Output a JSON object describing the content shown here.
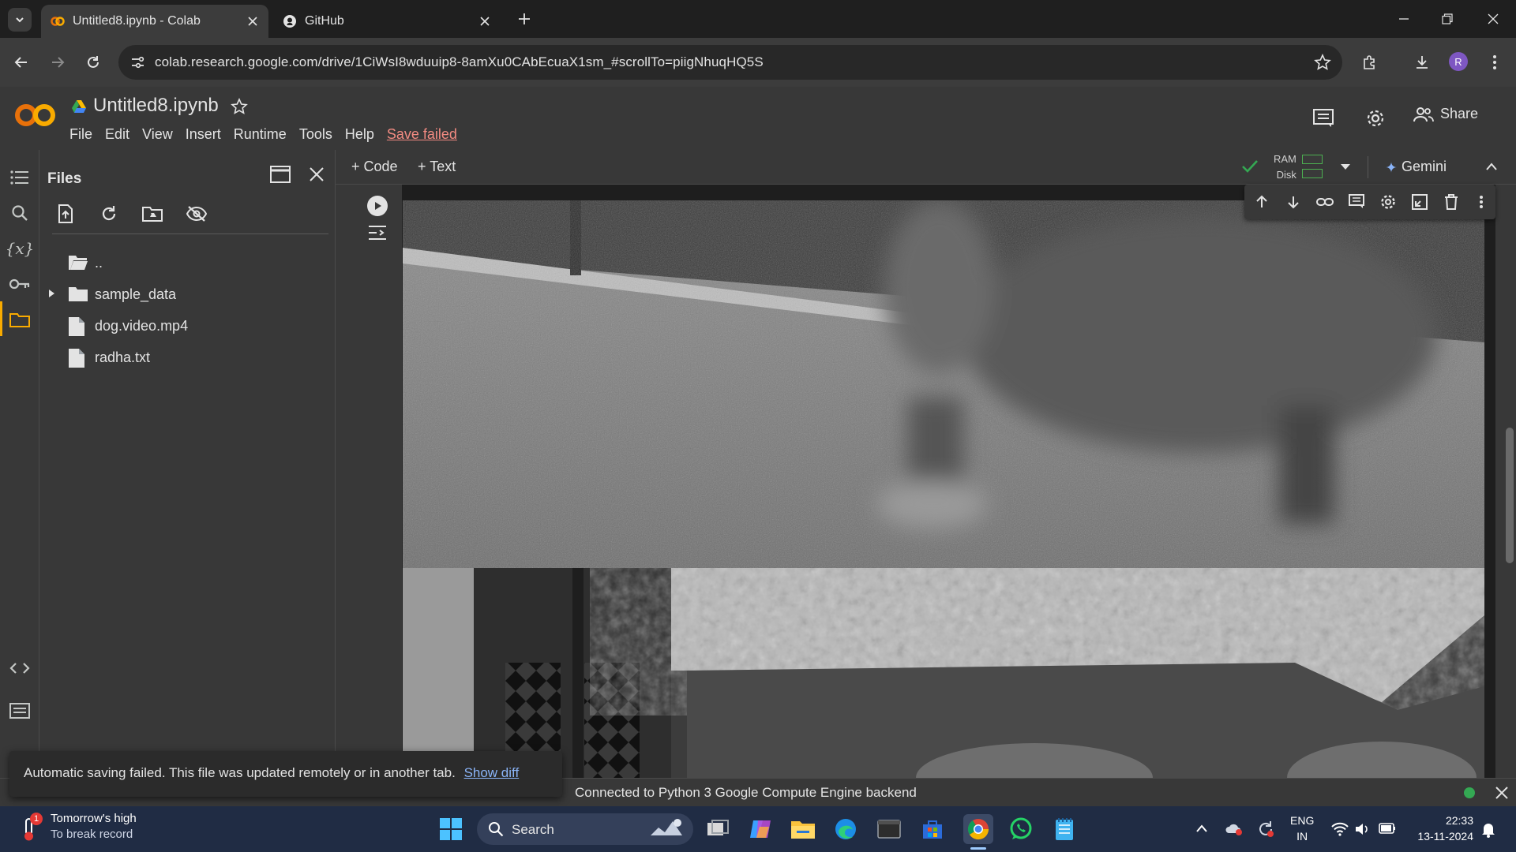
{
  "browser": {
    "tabs": [
      {
        "title": "Untitled8.ipynb - Colab",
        "active": true
      },
      {
        "title": "GitHub",
        "active": false
      }
    ],
    "url": "colab.research.google.com/drive/1CiWsI8wduuip8-8amXu0CAbEcuaX1sm_#scrollTo=piigNhuqHQ5S",
    "profile_initial": "R"
  },
  "colab": {
    "notebook_title": "Untitled8.ipynb",
    "menu": [
      "File",
      "Edit",
      "View",
      "Insert",
      "Runtime",
      "Tools",
      "Help"
    ],
    "save_status": "Save failed",
    "share_label": "Share",
    "add_code": "+ Code",
    "add_text": "+ Text",
    "ram_label": "RAM",
    "disk_label": "Disk",
    "gemini_label": "Gemini"
  },
  "files": {
    "title": "Files",
    "items": [
      {
        "name": "..",
        "type": "parent-folder"
      },
      {
        "name": "sample_data",
        "type": "folder"
      },
      {
        "name": "dog.video.mp4",
        "type": "file"
      },
      {
        "name": "radha.txt",
        "type": "file"
      }
    ]
  },
  "toast": {
    "message": "Automatic saving failed. This file was updated remotely or in another tab.",
    "link": "Show diff"
  },
  "status": {
    "message": "Connected to Python 3 Google Compute Engine backend"
  },
  "taskbar": {
    "weather_line1": "Tomorrow's high",
    "weather_line2": "To break record",
    "weather_badge": "1",
    "search_label": "Search",
    "lang1": "ENG",
    "lang2": "IN",
    "time": "22:33",
    "date": "13-11-2024"
  },
  "colors": {
    "accent_orange": "#f9ab00",
    "save_failed": "#f28b82",
    "link": "#8ab4f8",
    "connected": "#34a853"
  }
}
